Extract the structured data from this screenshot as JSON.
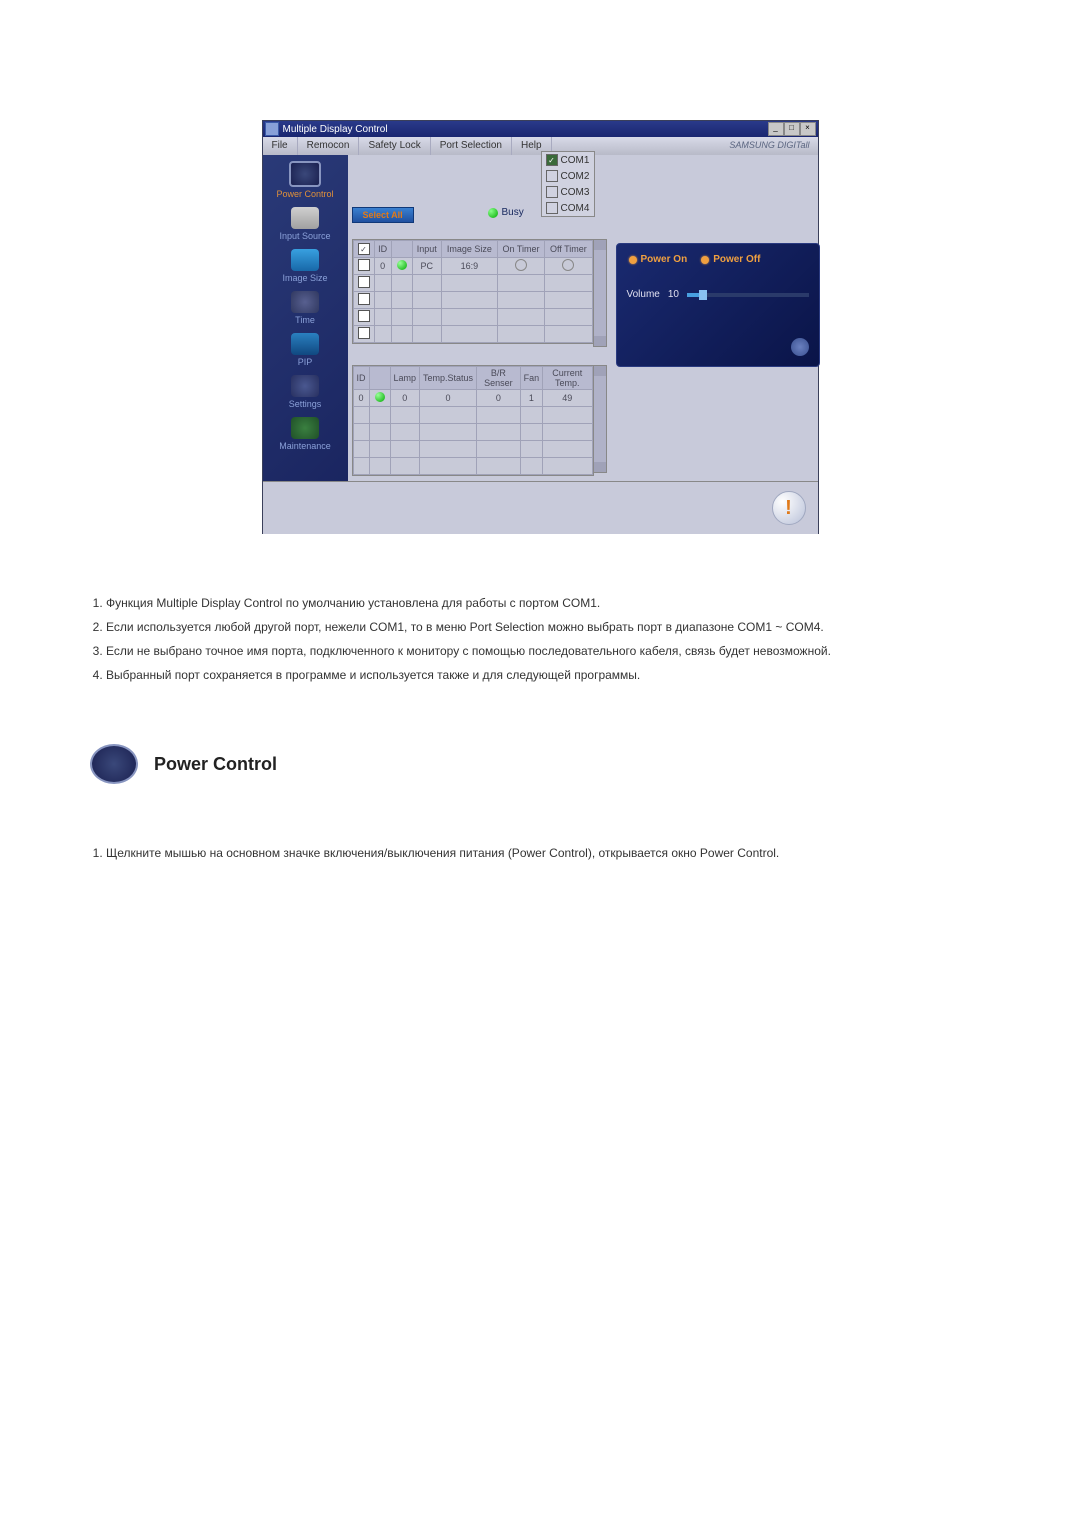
{
  "window": {
    "title": "Multiple Display Control",
    "brand": "SAMSUNG DIGITall"
  },
  "menubar": {
    "file": "File",
    "remocon": "Remocon",
    "safety_lock": "Safety Lock",
    "port_selection": "Port Selection",
    "help": "Help"
  },
  "port_menu": {
    "items": [
      {
        "label": "COM1",
        "checked": true
      },
      {
        "label": "COM2",
        "checked": false
      },
      {
        "label": "COM3",
        "checked": false
      },
      {
        "label": "COM4",
        "checked": false
      }
    ]
  },
  "sidebar": {
    "power": "Power Control",
    "input": "Input Source",
    "image": "Image Size",
    "time": "Time",
    "pip": "PIP",
    "settings": "Settings",
    "maintenance": "Maintenance"
  },
  "select_all": "Select All",
  "busy_label": "Busy",
  "grid1": {
    "headers": {
      "chk": "",
      "id": "ID",
      "pwr": "",
      "input": "Input",
      "imgsize": "Image Size",
      "ontimer": "On Timer",
      "offtimer": "Off Timer"
    },
    "row": {
      "id": "0",
      "input": "PC",
      "imgsize": "16:9",
      "ontimer": "O",
      "offtimer": "O"
    }
  },
  "grid2": {
    "headers": {
      "id": "ID",
      "pwr": "",
      "lamp": "Lamp",
      "temp_status": "Temp.Status",
      "brsenser": "B/R Senser",
      "fan": "Fan",
      "current_temp": "Current Temp."
    },
    "row": {
      "id": "0",
      "lamp": "0",
      "temp_status": "0",
      "brsenser": "0",
      "fan": "1",
      "current_temp": "49"
    }
  },
  "control": {
    "power_on": "Power On",
    "power_off": "Power Off",
    "volume_label": "Volume",
    "volume_value": "10"
  },
  "notes": {
    "n1": "Функция Multiple Display Control по умолчанию установлена для работы с портом COM1.",
    "n2": "Если используется любой другой порт, нежели COM1, то в меню Port Selection можно выбрать порт в диапазоне COM1 ~ COM4.",
    "n3": "Если не выбрано точное имя порта, подключенного к монитору с помощью последовательного кабеля, связь будет невозможной.",
    "n4": "Выбранный порт сохраняется в программе и используется также и для следующей программы."
  },
  "section_power": {
    "title": "Power Control",
    "item1": "Щелкните мышью на основном значке включения/выключения питания (Power Control), открывается окно Power Control."
  }
}
